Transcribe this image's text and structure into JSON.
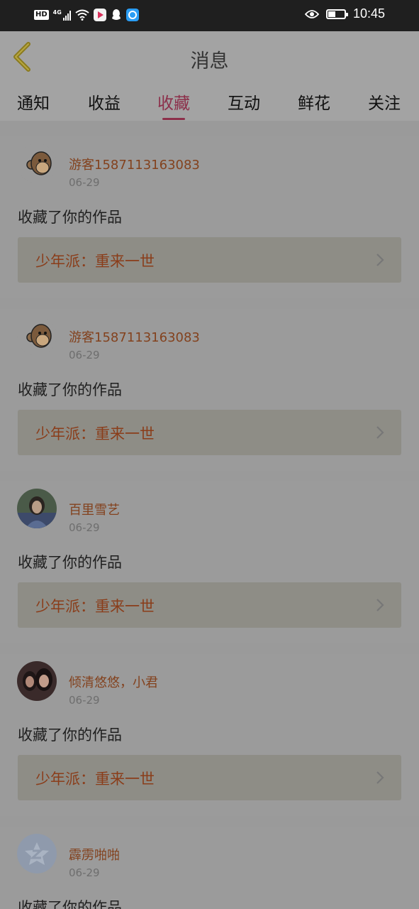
{
  "status_bar": {
    "hd": "HD",
    "network": "4G",
    "time": "10:45",
    "battery_level": 0.4,
    "icons": [
      "hd-icon",
      "signal-icon",
      "wifi-icon",
      "video-app-icon",
      "qq-icon",
      "browser-app-icon",
      "eye-icon",
      "battery-icon"
    ]
  },
  "header": {
    "title": "消息",
    "back_icon": "back-chevron-icon"
  },
  "tabs": [
    {
      "label": "通知",
      "active": false
    },
    {
      "label": "收益",
      "active": false
    },
    {
      "label": "收藏",
      "active": true
    },
    {
      "label": "互动",
      "active": false
    },
    {
      "label": "鲜花",
      "active": false
    },
    {
      "label": "关注",
      "active": false
    }
  ],
  "colors": {
    "accent": "#8c2f4a",
    "username": "#83421e",
    "work_title": "#8a3d1a"
  },
  "messages": [
    {
      "user": "游客1587113163083",
      "date": "06-29",
      "action": "收藏了你的作品",
      "work": "少年派：重来一世",
      "avatar": "monkey-avatar-icon"
    },
    {
      "user": "游客1587113163083",
      "date": "06-29",
      "action": "收藏了你的作品",
      "work": "少年派：重来一世",
      "avatar": "monkey-avatar-icon"
    },
    {
      "user": "百里雪艺",
      "date": "06-29",
      "action": "收藏了你的作品",
      "work": "少年派：重来一世",
      "avatar": "photo-avatar"
    },
    {
      "user": "倾清悠悠，小君",
      "date": "06-29",
      "action": "收藏了你的作品",
      "work": "少年派：重来一世",
      "avatar": "photo-avatar"
    },
    {
      "user": "霹雳啪啪",
      "date": "06-29",
      "action": "收藏了你的作品",
      "work": "",
      "avatar": "default-avatar-icon"
    }
  ]
}
